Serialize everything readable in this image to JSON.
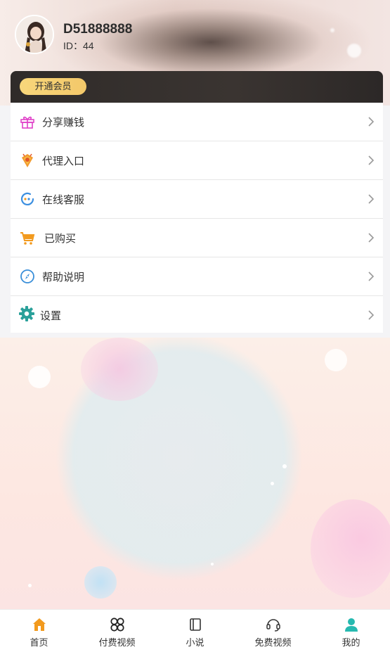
{
  "profile": {
    "username": "D51888888",
    "id_text": "ID：44"
  },
  "vip": {
    "button_label": "开通会员"
  },
  "menu": {
    "items": [
      {
        "label": "分享赚钱",
        "icon": "gift-icon",
        "color": "#e040c8"
      },
      {
        "label": "代理入口",
        "icon": "agent-badge-icon",
        "color": "#f29a2e"
      },
      {
        "label": "在线客服",
        "icon": "customer-service-icon",
        "color": "#3c8fe0"
      },
      {
        "label": "已购买",
        "icon": "shopping-cart-icon",
        "color": "#f29a1e"
      },
      {
        "label": "帮助说明",
        "icon": "help-compass-icon",
        "color": "#3a8fd9"
      },
      {
        "label": "设置",
        "icon": "gear-icon",
        "color": "#2aa09a"
      }
    ]
  },
  "tabbar": {
    "tabs": [
      {
        "label": "首页",
        "icon": "home-icon",
        "active_color": "#f29a1e"
      },
      {
        "label": "付费视频",
        "icon": "grid-circles-icon"
      },
      {
        "label": "小说",
        "icon": "book-icon"
      },
      {
        "label": "免费视频",
        "icon": "headset-icon"
      },
      {
        "label": "我的",
        "icon": "user-icon",
        "active_color": "#26b9b0"
      }
    ]
  }
}
